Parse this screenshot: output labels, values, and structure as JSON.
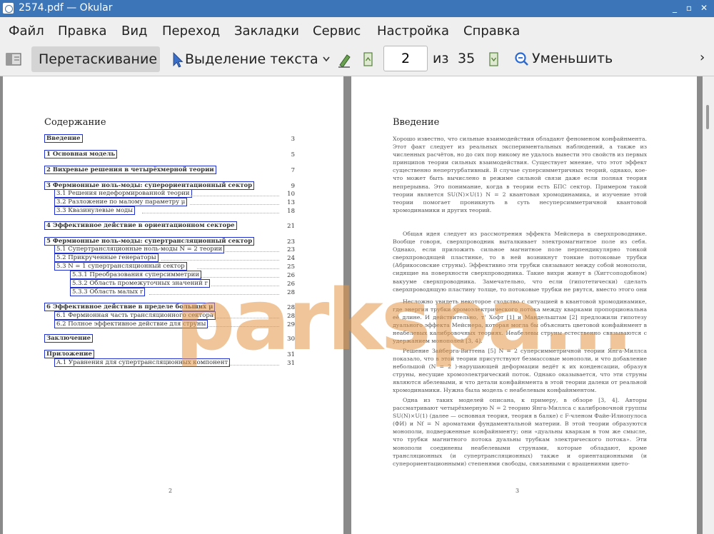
{
  "window": {
    "title": "2574.pdf  — Okular",
    "controls": [
      "_",
      "▫",
      "✕"
    ]
  },
  "menubar": {
    "items": [
      "Файл",
      "Правка",
      "Вид",
      "Переход",
      "Закладки",
      "Сервис",
      "Настройка",
      "Справка"
    ]
  },
  "toolbar": {
    "drag_label": "Перетаскивание",
    "select_label": "Выделение текста",
    "page_current": "2",
    "page_of": "из",
    "page_total": "35",
    "zoom_out_label": "Уменьшить",
    "overflow": "›"
  },
  "left_page": {
    "title": "Содержание",
    "page_number": "2",
    "toc": [
      {
        "text": "Введение",
        "page": "3"
      },
      {
        "text": "1   Основная модель",
        "page": "5"
      },
      {
        "text": "2   Вихревые решения в четырёхмерной теории",
        "page": "7"
      },
      {
        "text": "3   Фермионные ноль-моды: суперориентационный сектор",
        "page": "9"
      },
      {
        "text": "3.1   Решения недеформированной теории",
        "page": "10"
      },
      {
        "text": "3.2   Разложение по малому параметру μ",
        "page": "13"
      },
      {
        "text": "3.3   Квазинулевые моды",
        "page": "18"
      },
      {
        "text": "4   Эффективное действие в ориентационном секторе",
        "page": "21"
      },
      {
        "text": "5   Фермионные ноль-моды: супертрансляционный сектор",
        "page": "23"
      },
      {
        "text": "5.1   Супертрансляционные ноль-моды N = 2 теории",
        "page": "23"
      },
      {
        "text": "5.2   Прикрученные генераторы",
        "page": "24"
      },
      {
        "text": "5.3   N = 1 супертрансляционный сектор",
        "page": "25"
      },
      {
        "text": "5.3.1   Преобразования суперсимметрии",
        "page": "26"
      },
      {
        "text": "5.3.2   Область промежуточных значений r",
        "page": "26"
      },
      {
        "text": "5.3.3   Область малых r",
        "page": "28"
      },
      {
        "text": "6   Эффективное действие в пределе больших μ",
        "page": "28"
      },
      {
        "text": "6.1   Фермионная часть трансляционного сектора",
        "page": "28"
      },
      {
        "text": "6.2   Полное эффективное действие для струны",
        "page": "29"
      },
      {
        "text": "Заключение",
        "page": "30"
      },
      {
        "text": "Приложение",
        "page": "31"
      },
      {
        "text": "A.1   Уравнения для супертрансляционных компонент",
        "page": "31"
      }
    ]
  },
  "right_page": {
    "title": "Введение",
    "page_number": "3",
    "paragraphs": [
      "Хорошо известно, что сильные взаимодействия обладают феноменом конфайнмента. Этот факт следует из реальных экспериментальных наблюдений, а также из численных расчётов, но до сих пор никому не удалось вывести это свойств из первых принципов теории сильных взаимодействия. Существует мнение, что этот эффект существенно непертурбативный. В случае суперсимметричных теорий, однако, кое-что может быть вычислено в режиме сильной связи даже если полная теория непрерывна. Это понимание, когда в теории есть БПС сектор. Примером такой теории является SU(N)×U(1) N = 2 квантовая хромодинамика, и изучение этой теории помогает проникнуть в суть несуперсимметричной квантовой хромодинамики и других теорий.",
      "Общая идея следует из рассмотрения эффекта Мейснера в сверхпроводнике. Вообще говоря, сверхпроводник выталкивает электромагнитное поле из себя. Однако, если приложить сильное магнитное поле перпендикулярно тонкой сверхпроводящей пластинке, то в ней возникнут тонкие потоковые трубки (Абрикосовские струны). Эффективно эти трубки связывают между собой монополи, сидящие на поверхности сверхпроводника. Такие вихри живут в (Хиггсоподобном) вакууме сверхпроводника. Замечательно, что если (гипотетически) сделать сверхпроводящую пластину толще, то потоковые трубки не рвутся, вместо этого они удлиняются, и их энергия пропорциональна их длине.",
      "Несложно увидеть некоторое сходство с ситуацией в квантовой хромодинамике, где энергия трубки хромоэлектрического потока между кварками пропорциональна её длине. И действительно, т' Хофт [1] и Мандельштам [2] предложили гипотезу дуального эффекта Мейснера, которая могла бы объяснить цветовой конфайнмент в неабелевых калибровочных теориях. Неабелевы струны естественно связываются с удержанием монополей [3, 4].",
      "Решение Зайберга-Виттена [5] N = 2 суперсимметричной теории Янга-Миллса показало, что в этой теории присутствуют безмассовые монополи, и что добавление небольшой (N = 2 )-нарушающей деформации ведёт к их конденсации, образуя струны, несущие хромоэлектрический поток. Однако оказывается, что эти струны являются абелевыми, и что детали конфайнмента в этой теории далеки от реальной хромодинамики. Нужна была модель с неабелевым конфайнментом.",
      "Одна из таких моделей описана, к примеру, в обзоре [3, 4]. Авторы рассматривают четырёхмерную N = 2 теорию Янга-Миллса с калибровочной группы SU(N)×U(1) (далее — основная теория, теория в балке) с F-членом Файе-Илиопулоса (ФИ) и Nf = N ароматами фундаментальной материи. В этой теории образуются монополи, подверженные конфайнменту; они «дуальны кваркам в том же смысле, что трубки магнитного потока дуальны трубкам электрического потока». Эти монополи соединены неабелевыми струнами, которые обладают, кроме трансляционных (и супертрансляционных) также и ориентационными (и суперориентационными) степенями свободы, связанными с вращениями цвето-"
    ]
  },
  "watermark": "parkspa..."
}
